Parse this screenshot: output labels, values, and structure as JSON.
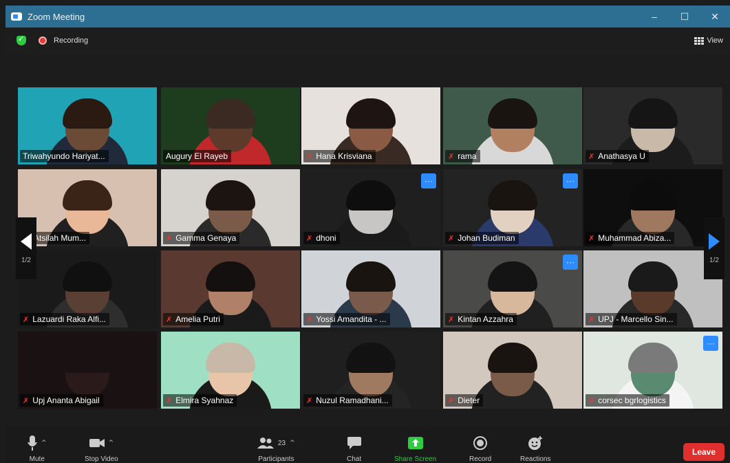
{
  "window": {
    "title": "Zoom Meeting",
    "minimize": "–",
    "maximize": "☐",
    "close": "✕"
  },
  "meeting": {
    "recording_label": "Recording",
    "view_label": "View"
  },
  "pager": {
    "prev_page": "1/2",
    "next_page": "1/2"
  },
  "participants": [
    {
      "name": "Triwahyundo Hariyat...",
      "muted": false,
      "active_speaker": true,
      "more": false
    },
    {
      "name": "Augury El Rayeb",
      "muted": false,
      "active_speaker": false,
      "more": false
    },
    {
      "name": "Hana Krisviana",
      "muted": true,
      "active_speaker": false,
      "more": false
    },
    {
      "name": "rama",
      "muted": true,
      "active_speaker": false,
      "more": false
    },
    {
      "name": "Anathasya U",
      "muted": true,
      "active_speaker": false,
      "more": false
    },
    {
      "name": "an Atsilah Mum...",
      "muted": false,
      "active_speaker": false,
      "more": false
    },
    {
      "name": "Gamma Genaya",
      "muted": true,
      "active_speaker": false,
      "more": false
    },
    {
      "name": "dhoni",
      "muted": true,
      "active_speaker": false,
      "more": true
    },
    {
      "name": "Johan Budiman",
      "muted": true,
      "active_speaker": false,
      "more": true
    },
    {
      "name": "Muhammad Abiza...",
      "muted": true,
      "active_speaker": false,
      "more": false
    },
    {
      "name": "Lazuardi Raka Alfi...",
      "muted": true,
      "active_speaker": false,
      "more": false
    },
    {
      "name": "Amelia Putri",
      "muted": true,
      "active_speaker": false,
      "more": false
    },
    {
      "name": "Yossi Amandita - ...",
      "muted": true,
      "active_speaker": false,
      "more": false
    },
    {
      "name": "Kintan Azzahra",
      "muted": true,
      "active_speaker": false,
      "more": true
    },
    {
      "name": "UPJ - Marcello Sin...",
      "muted": true,
      "active_speaker": false,
      "more": false
    },
    {
      "name": "Upj Ananta Abigail",
      "muted": true,
      "active_speaker": false,
      "more": false
    },
    {
      "name": "Elmira Syahnaz",
      "muted": true,
      "active_speaker": false,
      "more": false
    },
    {
      "name": "Nuzul Ramadhani...",
      "muted": true,
      "active_speaker": false,
      "more": false
    },
    {
      "name": "Dieter",
      "muted": true,
      "active_speaker": false,
      "more": false
    },
    {
      "name": "corsec bgrlogistics",
      "muted": true,
      "active_speaker": false,
      "more": true
    }
  ],
  "toolbar": {
    "mute_label": "Mute",
    "stop_video_label": "Stop Video",
    "participants_label": "Participants",
    "participants_count": "23",
    "chat_label": "Chat",
    "share_screen_label": "Share Screen",
    "record_label": "Record",
    "reactions_label": "Reactions",
    "leave_label": "Leave"
  },
  "colors": {
    "titlebar": "#2d6f93",
    "active_outline": "#f3e33c",
    "accent_blue": "#2d8cff",
    "leave_red": "#e02f2f",
    "share_green": "#2ecc40"
  },
  "icons": [
    "zoom-logo-icon",
    "shield-icon",
    "recording-icon",
    "grid-view-icon",
    "mic-icon",
    "video-camera-icon",
    "participants-icon",
    "chat-icon",
    "share-screen-icon",
    "record-icon",
    "reactions-icon",
    "mic-muted-icon",
    "more-options-icon",
    "chevron-left-icon",
    "chevron-right-icon",
    "chevron-up-icon"
  ]
}
